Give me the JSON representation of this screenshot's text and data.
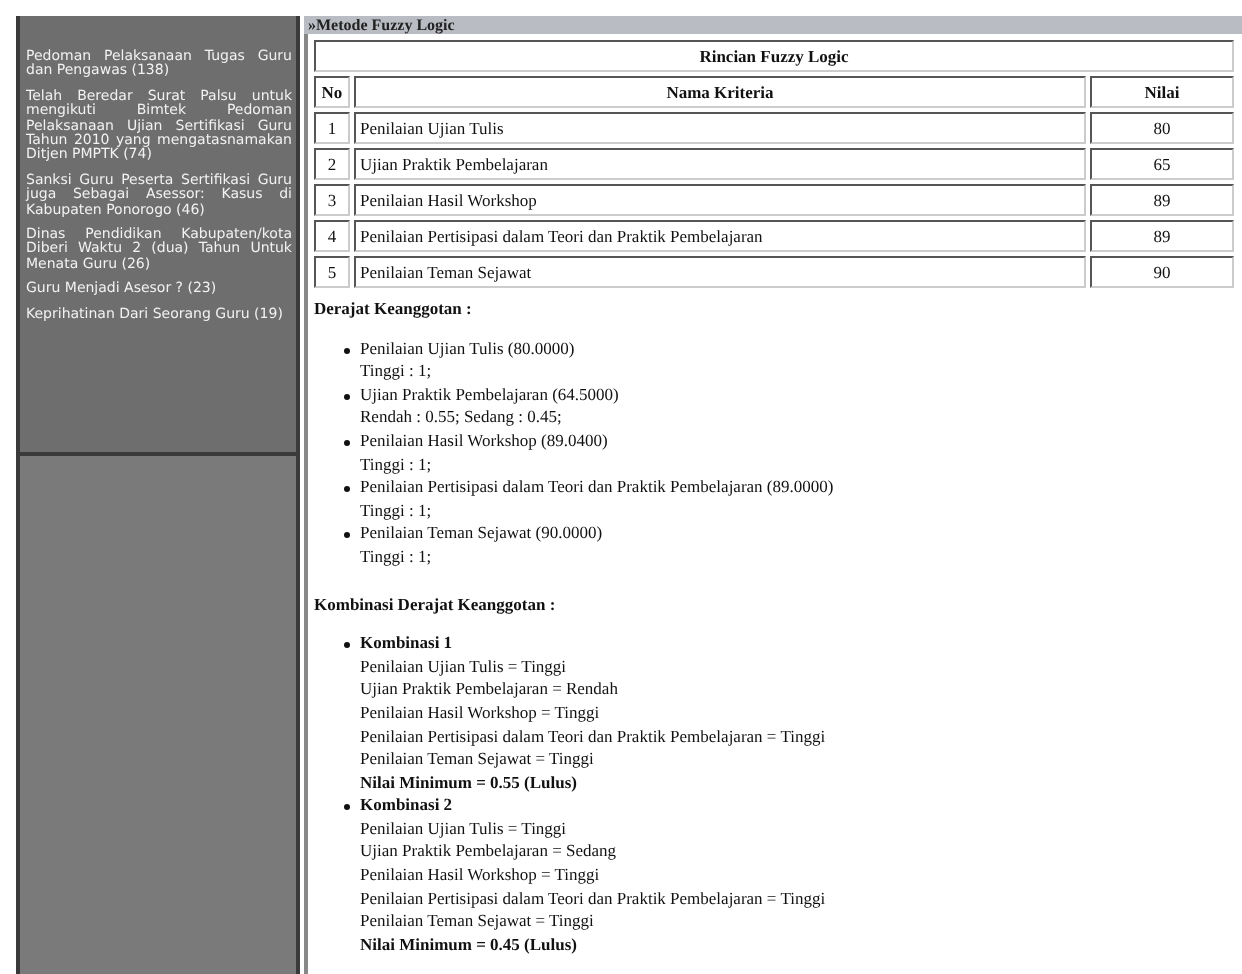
{
  "sidebar": {
    "items": [
      {
        "text": "Pedoman Pelaksanaan Tugas Guru dan Pengawas (138)"
      },
      {
        "text": "Telah Beredar Surat Palsu untuk mengikuti Bimtek Pedoman Pelaksanaan Ujian Sertifikasi Guru Tahun 2010 yang mengatasnamakan Ditjen PMPTK (74)"
      },
      {
        "text": "Sanksi Guru Peserta Sertifikasi Guru juga Sebagai Asessor: Kasus di Kabupaten Ponorogo (46)"
      },
      {
        "text": "Dinas Pendidikan Kabupaten/kota Diberi Waktu 2 (dua) Tahun Untuk Menata Guru (26)"
      },
      {
        "text": "Guru Menjadi Asesor ? (23)"
      },
      {
        "text": "Keprihatinan Dari Seorang Guru (19)"
      }
    ]
  },
  "section_title": "»Metode Fuzzy Logic",
  "table": {
    "title": "Rincian Fuzzy Logic",
    "columns": [
      "No",
      "Nama Kriteria",
      "Nilai"
    ],
    "rows": [
      [
        "1",
        "Penilaian Ujian Tulis",
        "80"
      ],
      [
        "2",
        "Ujian Praktik Pembelajaran",
        "65"
      ],
      [
        "3",
        "Penilaian Hasil Workshop",
        "89"
      ],
      [
        "4",
        "Penilaian Pertisipasi dalam Teori dan Praktik Pembelajaran",
        "89"
      ],
      [
        "5",
        "Penilaian Teman Sejawat",
        "90"
      ]
    ]
  },
  "membership": {
    "heading": "Derajat Keanggotan :",
    "items": [
      {
        "label": "Penilaian Ujian Tulis (80.0000)",
        "detail": "Tinggi : 1;"
      },
      {
        "label": "Ujian Praktik Pembelajaran (64.5000)",
        "detail": "Rendah : 0.55; Sedang : 0.45;"
      },
      {
        "label": "Penilaian Hasil Workshop (89.0400)",
        "detail": "Tinggi : 1;"
      },
      {
        "label": "Penilaian Pertisipasi dalam Teori dan Praktik Pembelajaran (89.0000)",
        "detail": "Tinggi : 1;"
      },
      {
        "label": "Penilaian Teman Sejawat (90.0000)",
        "detail": "Tinggi : 1;"
      }
    ]
  },
  "combinations": {
    "heading": "Kombinasi Derajat Keanggotan :",
    "items": [
      {
        "title": "Kombinasi 1",
        "lines": [
          "Penilaian Ujian Tulis = Tinggi",
          "Ujian Praktik Pembelajaran = Rendah",
          "Penilaian Hasil Workshop = Tinggi",
          "Penilaian Pertisipasi dalam Teori dan Praktik Pembelajaran = Tinggi",
          "Penilaian Teman Sejawat = Tinggi"
        ],
        "result": "Nilai Minimum = 0.55 (Lulus)"
      },
      {
        "title": "Kombinasi 2",
        "lines": [
          "Penilaian Ujian Tulis = Tinggi",
          "Ujian Praktik Pembelajaran = Sedang",
          "Penilaian Hasil Workshop = Tinggi",
          "Penilaian Pertisipasi dalam Teori dan Praktik Pembelajaran = Tinggi",
          "Penilaian Teman Sejawat = Tinggi"
        ],
        "result": "Nilai Minimum = 0.45 (Lulus)"
      }
    ]
  }
}
